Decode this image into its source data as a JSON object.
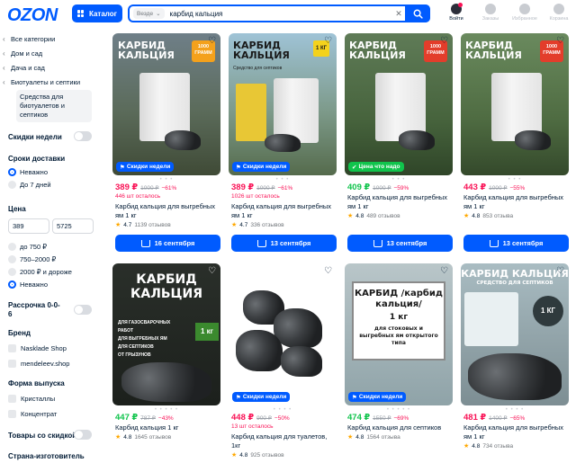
{
  "header": {
    "logo": "OZON",
    "catalog_label": "Каталог",
    "search_scope": "Везде",
    "search_query": "карбид кальция",
    "icons": [
      {
        "name": "Войти",
        "icon": "user-icon"
      },
      {
        "name": "Заказы",
        "icon": "box-icon"
      },
      {
        "name": "Избранное",
        "icon": "heart-icon"
      },
      {
        "name": "Корзина",
        "icon": "cart-icon"
      }
    ]
  },
  "sidebar": {
    "categories": [
      "Все категории",
      "Дом и сад",
      "Дача и сад",
      "Биотуалеты и септики"
    ],
    "selected_category": "Средства для биотуалетов и септиков",
    "weekly_discounts": "Скидки недели",
    "delivery_title": "Сроки доставки",
    "delivery_options": [
      "Неважно",
      "До 7 дней"
    ],
    "price_title": "Цена",
    "price_min": "389",
    "price_max": "5725",
    "price_options": [
      "до 750 ₽",
      "750–2000 ₽",
      "2000 ₽ и дороже",
      "Неважно"
    ],
    "installment": "Рассрочка 0-0-6",
    "brand_title": "Бренд",
    "brands": [
      "Nasklade Shop",
      "mendeleev.shop"
    ],
    "form_title": "Форма выпуска",
    "forms": [
      "Кристаллы",
      "Концентрат"
    ],
    "discount_goods": "Товары со скидкой",
    "country_title": "Страна-изготовитель"
  },
  "products": [
    {
      "badge": "Скидки недели",
      "price": "389 ₽",
      "old": "1000 ₽",
      "discount": "−61%",
      "stock": "446 шт осталось",
      "name": "Карбид кальция для выгребных ям 1 кг",
      "rating": "4.7",
      "reviews": "1139 отзывов",
      "cta": "16 сентября",
      "img_title": "КАРБИД КАЛЬЦИЯ",
      "img_weight": "1000 ГРАММ"
    },
    {
      "badge": "Скидки недели",
      "price": "389 ₽",
      "old": "1000 ₽",
      "discount": "−61%",
      "stock": "1026 шт осталось",
      "name": "Карбид кальция для выгребных ям 1 кг",
      "rating": "4.7",
      "reviews": "336 отзывов",
      "cta": "13 сентября",
      "img_title": "КАРБИД КАЛЬЦИЯ",
      "img_sub": "Средство для септиков",
      "img_weight": "1 КГ"
    },
    {
      "badge": "Цена что надо",
      "price": "409 ₽",
      "old": "1000 ₽",
      "discount": "−59%",
      "stock": "",
      "name": "Карбид кальция для выгребных ям 1 кг",
      "rating": "4.8",
      "reviews": "489 отзывов",
      "cta": "13 сентября",
      "img_title": "КАРБИД КАЛЬЦИЯ",
      "img_weight": "1000 ГРАММ"
    },
    {
      "badge": "",
      "price": "443 ₽",
      "old": "1000 ₽",
      "discount": "−55%",
      "stock": "",
      "name": "Карбид кальция для выгребных ям 1 кг",
      "rating": "4.8",
      "reviews": "853 отзыва",
      "cta": "13 сентября",
      "img_title": "КАРБИД КАЛЬЦИЯ",
      "img_weight": "1000 ГРАММ"
    },
    {
      "badge": "",
      "price": "447 ₽",
      "old": "787 ₽",
      "discount": "−43%",
      "stock": "",
      "name": "Карбид кальция 1 кг",
      "rating": "4.8",
      "reviews": "1645 отзывов",
      "cta": "",
      "img_title": "КАРБИД КАЛЬЦИЯ",
      "img_weight": "1 кг",
      "img_lines": [
        "ДЛЯ ГАЗОСВАРОЧНЫХ РАБОТ",
        "ДЛЯ ВЫГРЕБНЫХ ЯМ",
        "ДЛЯ СЕПТИКОВ",
        "ОТ ГРЫЗУНОВ"
      ]
    },
    {
      "badge": "Скидки недели",
      "price": "448 ₽",
      "old": "900 ₽",
      "discount": "−50%",
      "stock": "13 шт осталось",
      "name": "Карбид кальция для туалетов, 1кг",
      "rating": "4.8",
      "reviews": "925 отзывов",
      "cta": ""
    },
    {
      "badge": "Скидки недели",
      "price": "474 ₽",
      "old": "1550 ₽",
      "discount": "−69%",
      "stock": "",
      "name": "Карбид кальция для септиков",
      "rating": "4.8",
      "reviews": "1564 отзыва",
      "cta": "",
      "img_title": "КАРБИД /карбид кальция/",
      "img_weight": "1 кг",
      "img_sub": "для стоковых и выгребных ям открытого типа"
    },
    {
      "badge": "",
      "price": "481 ₽",
      "old": "1400 ₽",
      "discount": "−65%",
      "stock": "",
      "name": "Карбид кальция для выгребных ям 1 кг",
      "rating": "4.8",
      "reviews": "734 отзыва",
      "cta": "",
      "img_title": "КАРБИД КАЛЬЦИЯ",
      "img_sub": "СРЕДСТВО ДЛЯ СЕПТИКОВ",
      "img_weight": "1 КГ"
    }
  ]
}
